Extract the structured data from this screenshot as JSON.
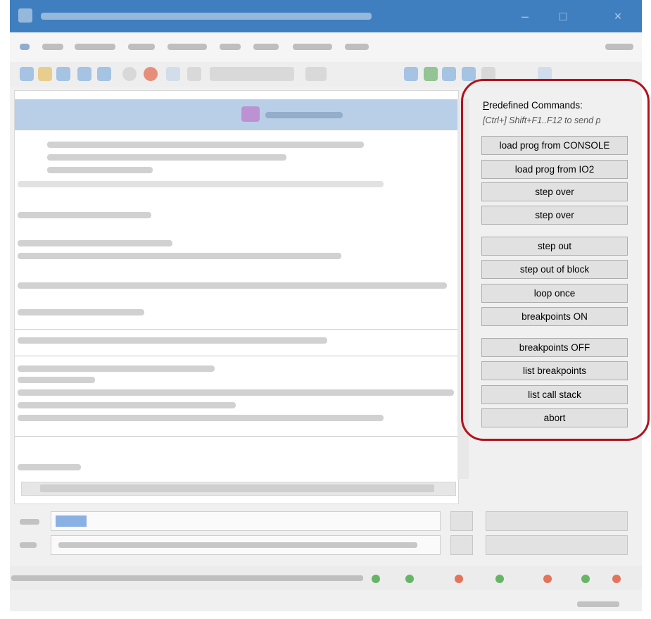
{
  "panel": {
    "title_prefix": "P",
    "title_rest": "redefined Commands:",
    "hint": "[Ctrl+] Shift+F1..F12 to send p",
    "buttons": [
      "load prog from CONSOLE",
      "load prog from IO2",
      "step over",
      "step over",
      "step out",
      "step out of block",
      "loop once",
      "breakpoints ON",
      "breakpoints OFF",
      "list breakpoints",
      "list call stack",
      "abort"
    ]
  },
  "icons": [
    "app-icon",
    "minimize-icon",
    "maximize-icon",
    "close-icon"
  ],
  "colors": {
    "highlight": "#b3121d",
    "titlebar": "#3f7fbf",
    "terminal_header": "#b9cfe8",
    "status_green": "#2e9e2e",
    "status_red": "#e0401c"
  }
}
